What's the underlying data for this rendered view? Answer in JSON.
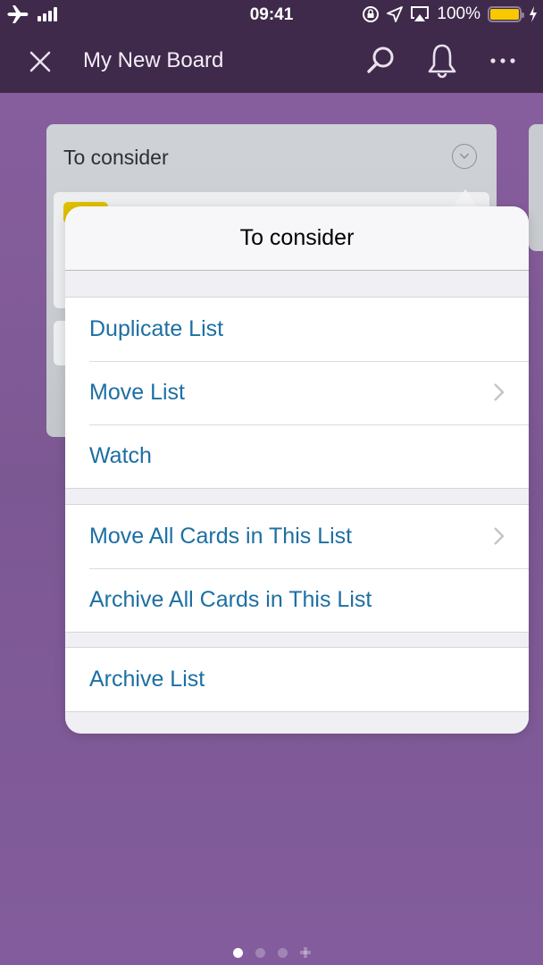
{
  "status_bar": {
    "time": "09:41",
    "battery_percent": "100%",
    "battery_level": 1.0,
    "icons": [
      "airplane-icon",
      "signal-icon",
      "rotation-lock-icon",
      "location-icon",
      "airplay-icon",
      "battery-icon",
      "charging-icon"
    ]
  },
  "navbar": {
    "title": "My New Board",
    "icons": [
      "close-icon",
      "search-icon",
      "bell-icon",
      "more-icon"
    ]
  },
  "board": {
    "list_title": "To consider",
    "card_label_color": "#e2c100"
  },
  "popover": {
    "title": "To consider",
    "groups": [
      [
        {
          "label": "Duplicate List",
          "has_submenu": false
        },
        {
          "label": "Move List",
          "has_submenu": true
        },
        {
          "label": "Watch",
          "has_submenu": false
        }
      ],
      [
        {
          "label": "Move All Cards in This List",
          "has_submenu": true
        },
        {
          "label": "Archive All Cards in This List",
          "has_submenu": false
        }
      ],
      [
        {
          "label": "Archive List",
          "has_submenu": false
        }
      ]
    ]
  },
  "page_indicator": {
    "pages": 3,
    "current": 1,
    "has_add": true
  },
  "colors": {
    "nav_bg": "#3f2a4c",
    "board_bg": "#825c9c",
    "action_text": "#1d6fa3"
  }
}
